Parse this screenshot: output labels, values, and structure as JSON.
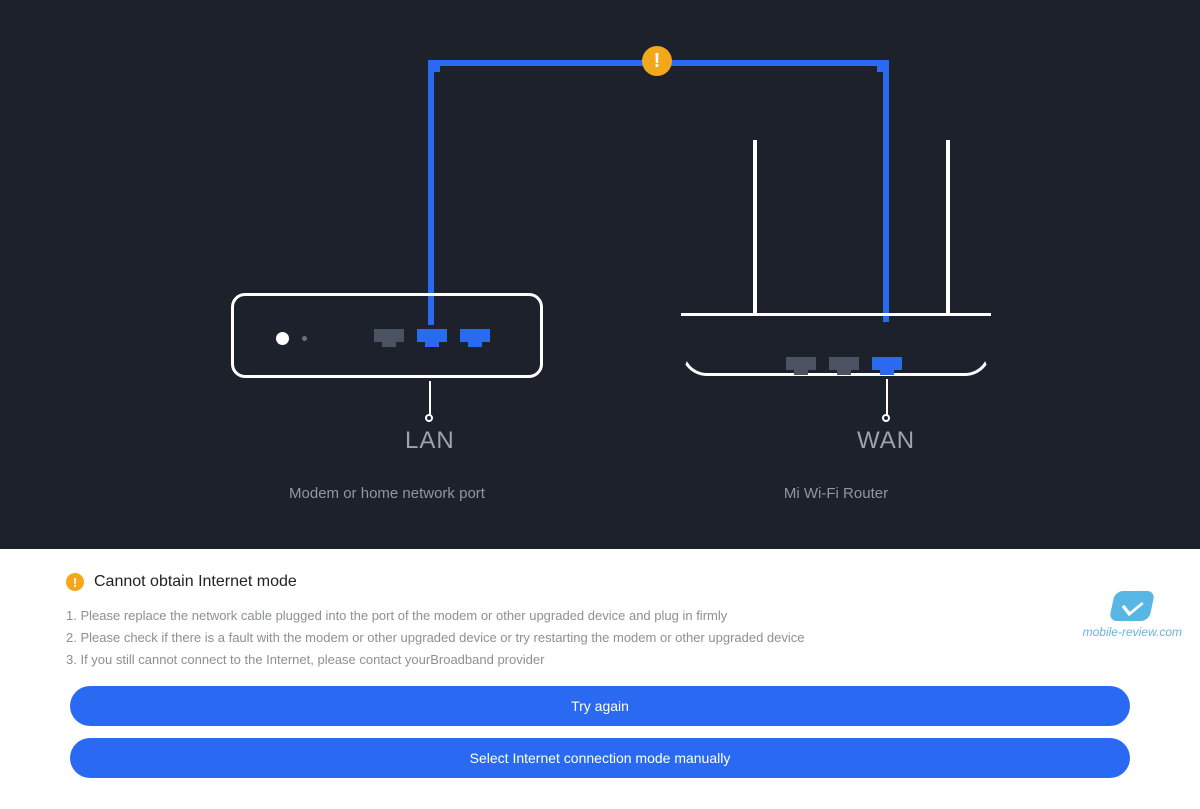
{
  "diagram": {
    "warning_glyph": "!",
    "lan_label": "LAN",
    "wan_label": "WAN",
    "modem_caption": "Modem or home network port",
    "router_caption": "Mi Wi-Fi Router"
  },
  "error": {
    "badge_glyph": "!",
    "title": "Cannot obtain Internet mode",
    "steps": [
      "1. Please replace the network cable plugged into the port of the modem or other upgraded device and plug in firmly",
      "2. Please check if there is a fault with the modem or other upgraded device or try restarting the modem or other upgraded device",
      "3. If you still cannot connect to the Internet, please contact yourBroadband provider"
    ]
  },
  "buttons": {
    "try_again": "Try again",
    "manual": "Select Internet connection mode manually"
  },
  "watermark": "mobile-review.com",
  "colors": {
    "bg_dark": "#1d212c",
    "accent_blue": "#2a6af2",
    "warn_orange": "#f3a81c"
  }
}
